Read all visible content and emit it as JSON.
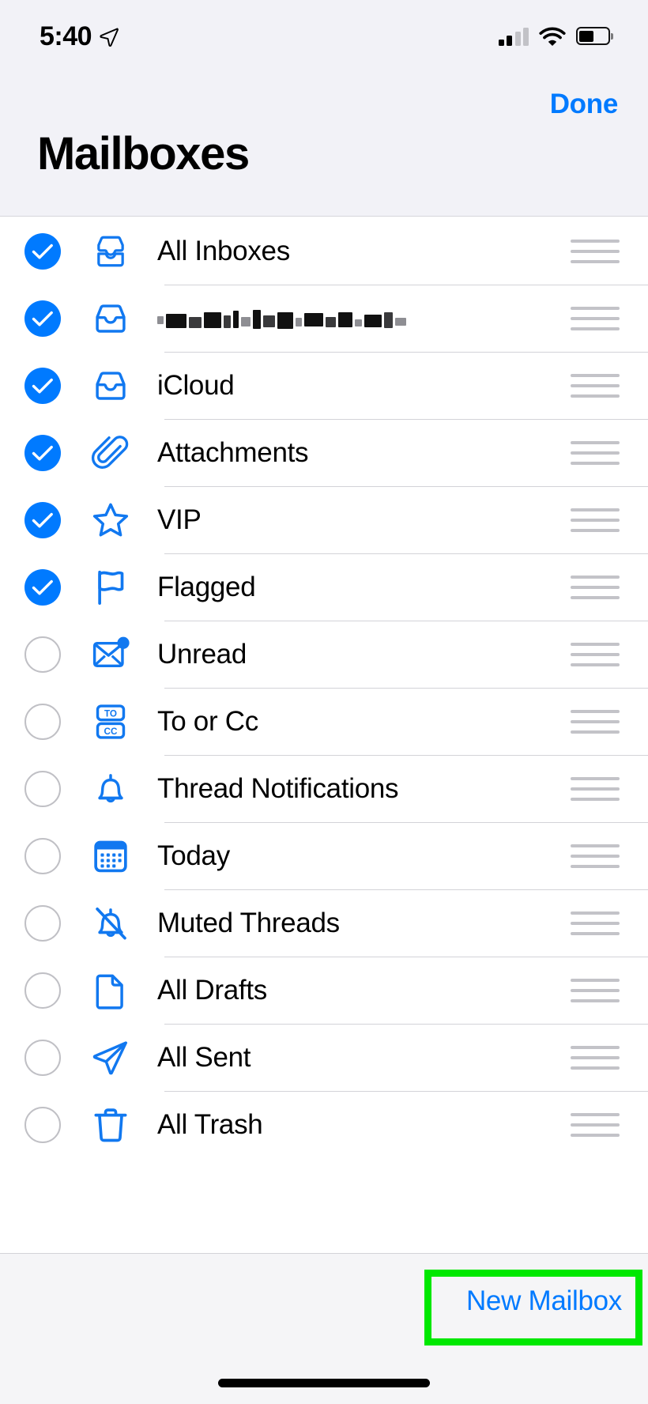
{
  "status_bar": {
    "time": "5:40",
    "location_icon": "location-arrow-icon",
    "signal_icon": "cellular-signal-icon",
    "wifi_icon": "wifi-icon",
    "battery_icon": "battery-icon",
    "battery_level_pct": 45
  },
  "header": {
    "title": "Mailboxes",
    "done_label": "Done",
    "background_color": "#f2f2f7"
  },
  "theme": {
    "accent_color": "#007aff",
    "list_background": "#ffffff",
    "separator_color": "#d3d3d8",
    "unchecked_circle_color": "#c0c0c5",
    "drag_handle_color": "#c3c3c8",
    "highlight_color": "#00e800"
  },
  "list": {
    "rows": [
      {
        "label": "All Inboxes",
        "icon": "all-inboxes-tray-icon",
        "checked": true,
        "redacted": false
      },
      {
        "label": "",
        "icon": "inbox-tray-icon",
        "checked": true,
        "redacted": true
      },
      {
        "label": "iCloud",
        "icon": "inbox-tray-icon",
        "checked": true,
        "redacted": false
      },
      {
        "label": "Attachments",
        "icon": "paperclip-icon",
        "checked": true,
        "redacted": false
      },
      {
        "label": "VIP",
        "icon": "star-icon",
        "checked": true,
        "redacted": false
      },
      {
        "label": "Flagged",
        "icon": "flag-icon",
        "checked": true,
        "redacted": false
      },
      {
        "label": "Unread",
        "icon": "unread-envelope-icon",
        "checked": false,
        "redacted": false
      },
      {
        "label": "To or Cc",
        "icon": "to-or-cc-icon",
        "checked": false,
        "redacted": false
      },
      {
        "label": "Thread Notifications",
        "icon": "bell-icon",
        "checked": false,
        "redacted": false
      },
      {
        "label": "Today",
        "icon": "calendar-icon",
        "checked": false,
        "redacted": false
      },
      {
        "label": "Muted Threads",
        "icon": "bell-slash-icon",
        "checked": false,
        "redacted": false
      },
      {
        "label": "All Drafts",
        "icon": "document-page-icon",
        "checked": false,
        "redacted": false
      },
      {
        "label": "All Sent",
        "icon": "paper-plane-icon",
        "checked": false,
        "redacted": false
      },
      {
        "label": "All Trash",
        "icon": "trash-icon",
        "checked": false,
        "redacted": false
      }
    ],
    "drag_handle_icon": "drag-handle-icon",
    "checked_icon": "checkmark-icon"
  },
  "toolbar": {
    "new_mailbox_label": "New Mailbox"
  }
}
